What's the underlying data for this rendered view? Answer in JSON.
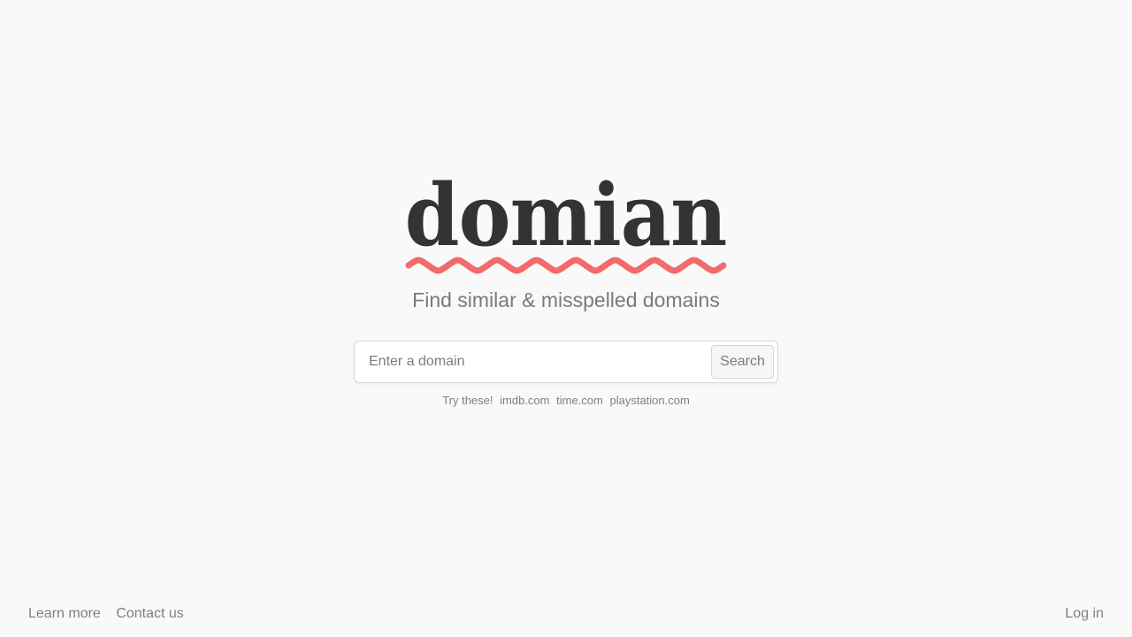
{
  "brand": {
    "logo_text": "domian",
    "logo_color": "#333333",
    "squiggle_color": "#f26a6a",
    "squiggle_icon": "wavy-underline"
  },
  "tagline": "Find similar & misspelled domains",
  "search": {
    "placeholder": "Enter a domain",
    "value": "",
    "button_label": "Search"
  },
  "suggestions": {
    "prefix": "Try these!",
    "items": [
      "imdb.com",
      "time.com",
      "playstation.com"
    ]
  },
  "footer": {
    "learn_more": "Learn more",
    "contact_us": "Contact us",
    "log_in": "Log in"
  }
}
